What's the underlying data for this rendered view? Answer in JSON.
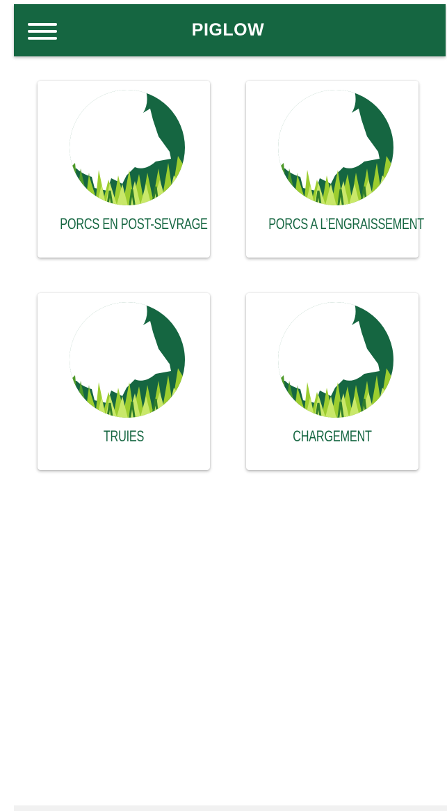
{
  "app_bar": {
    "title": "PIGLOW",
    "menu_icon": "hamburger-menu-icon",
    "background_color": "#156641"
  },
  "cards": [
    {
      "label": "PORCS EN POST-SEVRAGE",
      "icon": "pig-silhouette-logo"
    },
    {
      "label": "PORCS A L’ENGRAISSEMENT",
      "icon": "pig-silhouette-logo"
    },
    {
      "label": "TRUIES",
      "icon": "pig-silhouette-logo"
    },
    {
      "label": "CHARGEMENT",
      "icon": "pig-silhouette-logo"
    }
  ],
  "colors": {
    "brand_green": "#156641",
    "grass_light": "#9ccd2f",
    "grass_dark": "#4f9a2a"
  }
}
